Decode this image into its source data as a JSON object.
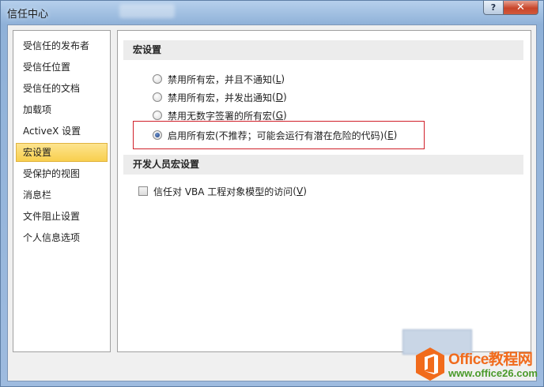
{
  "window": {
    "title": "信任中心",
    "help_label": "?",
    "close_label": "✕"
  },
  "sidebar": {
    "items": [
      {
        "label": "受信任的发布者",
        "selected": false
      },
      {
        "label": "受信任位置",
        "selected": false
      },
      {
        "label": "受信任的文档",
        "selected": false
      },
      {
        "label": "加载项",
        "selected": false
      },
      {
        "label": "ActiveX 设置",
        "selected": false
      },
      {
        "label": "宏设置",
        "selected": true
      },
      {
        "label": "受保护的视图",
        "selected": false
      },
      {
        "label": "消息栏",
        "selected": false
      },
      {
        "label": "文件阻止设置",
        "selected": false
      },
      {
        "label": "个人信息选项",
        "selected": false
      }
    ]
  },
  "macro_settings": {
    "header": "宏设置",
    "options": [
      {
        "label": "禁用所有宏，并且不通知",
        "hotkey": "L",
        "checked": false
      },
      {
        "label": "禁用所有宏，并发出通知",
        "hotkey": "D",
        "checked": false
      },
      {
        "label": "禁用无数字签署的所有宏",
        "hotkey": "G",
        "checked": false
      },
      {
        "label": "启用所有宏(不推荐；可能会运行有潜在危险的代码)",
        "hotkey": "E",
        "checked": true
      }
    ]
  },
  "developer_settings": {
    "header": "开发人员宏设置",
    "trust_vba": {
      "label": "信任对 VBA 工程对象模型的访问",
      "hotkey": "V",
      "checked": false
    }
  },
  "watermark": {
    "title": "Office教程网",
    "url": "www.office26.com"
  },
  "colors": {
    "selection": "#f8cf4e",
    "highlight_box": "#d0202a",
    "watermark_orange": "#f16b1c",
    "watermark_green": "#4a9a2a"
  }
}
